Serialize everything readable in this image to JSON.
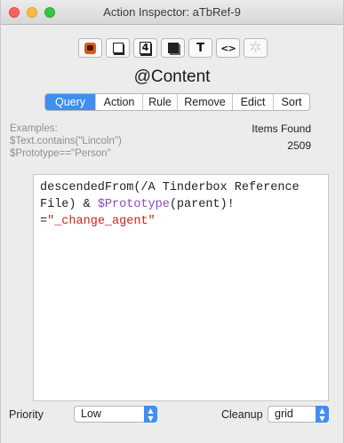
{
  "window": {
    "title": "Action Inspector: aTbRef-9"
  },
  "toolbar": {
    "buttons": [
      {
        "icon": "app-badge-icon"
      },
      {
        "icon": "note-square-icon"
      },
      {
        "icon": "number-4-icon",
        "glyph": "4"
      },
      {
        "icon": "dark-note-icon"
      },
      {
        "icon": "text-icon",
        "glyph": "T"
      },
      {
        "icon": "code-icon",
        "glyph": "<>"
      },
      {
        "icon": "gear-icon",
        "glyph": "✲"
      }
    ]
  },
  "section": {
    "title": "@Content"
  },
  "tabs": [
    {
      "label": "Query",
      "active": true
    },
    {
      "label": "Action"
    },
    {
      "label": "Rule"
    },
    {
      "label": "Remove"
    },
    {
      "label": "Edict"
    },
    {
      "label": "Sort"
    }
  ],
  "examples": {
    "heading": "Examples:",
    "lines": [
      "$Text.contains(\"Lincoln\")",
      "$Prototype==\"Person\""
    ]
  },
  "items_found": {
    "label": "Items Found",
    "count": "2509"
  },
  "query": {
    "part1": "descendedFrom(/A Tinderbox Reference File) & ",
    "attr": "$Prototype",
    "part2": "(parent)!\n=",
    "string": "\"_change_agent\""
  },
  "priority": {
    "label": "Priority",
    "value": "Low"
  },
  "cleanup": {
    "label": "Cleanup",
    "value": "grid"
  },
  "colors": {
    "accent": "#3f8ef2",
    "attribute": "#8c4aba",
    "string": "#c4271d"
  }
}
